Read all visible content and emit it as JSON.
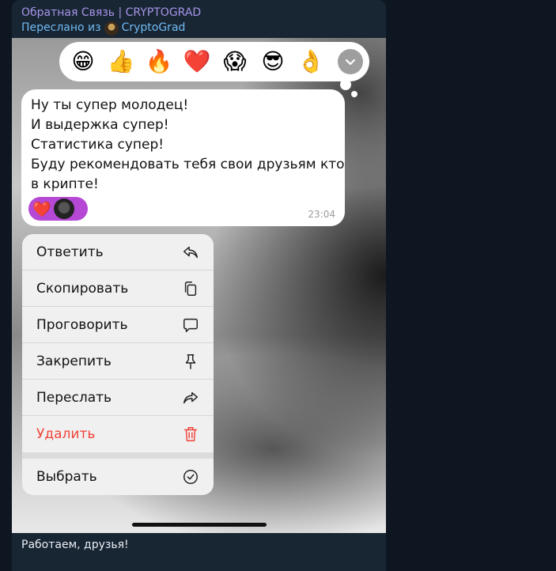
{
  "header": {
    "sender": "Обратная Связь | CRYPTOGRAD",
    "forwarded_prefix": "Переслано из",
    "forwarded_channel": "CryptoGrad"
  },
  "reaction_bar": {
    "emojis": [
      "😁",
      "👍",
      "🔥",
      "❤️",
      "😱",
      "😎",
      "👌"
    ]
  },
  "message": {
    "lines": [
      "Ну ты супер молодец!",
      "И выдержка супер!",
      "Статистика супер!",
      "Буду рекомендовать тебя свои друзьям кто",
      "в крипте!"
    ],
    "reaction": "❤️",
    "time": "23:04"
  },
  "menu": {
    "reply": "Ответить",
    "copy": "Скопировать",
    "speak": "Проговорить",
    "pin": "Закрепить",
    "forward": "Переслать",
    "delete": "Удалить",
    "select": "Выбрать"
  },
  "caption": "Работаем, друзья!",
  "colors": {
    "sender": "#a695e7",
    "forwarded": "#71baf2",
    "delete": "#f0443a",
    "reaction_pill": "#b549d6"
  }
}
